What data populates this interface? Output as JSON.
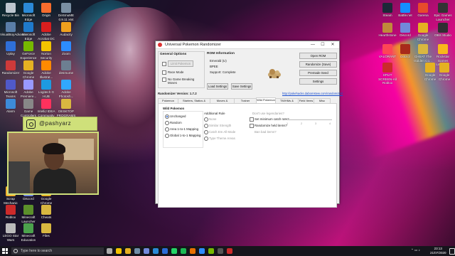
{
  "desktop_left": [
    {
      "label": "Recycle Bin",
      "color": "#bcc6cf"
    },
    {
      "label": "Microsoft Edge",
      "color": "#2b8ad6"
    },
    {
      "label": "Origin",
      "color": "#f56c2d"
    },
    {
      "label": "DeSmuME 0.9.11 x64",
      "color": "#7a8fa3"
    },
    {
      "label": "VisualBoyAdvance",
      "color": "#5a7ea8"
    },
    {
      "label": "Microsoft Edge",
      "color": "#1f7acb"
    },
    {
      "label": "Adobe Acrobat DC",
      "color": "#d81e1e"
    },
    {
      "label": "Audacity",
      "color": "#f0a01e"
    },
    {
      "label": "Uplay",
      "color": "#2f6fd8"
    },
    {
      "label": "GeForce Experience",
      "color": "#76b900"
    },
    {
      "label": "Norton Security",
      "color": "#f3c400"
    },
    {
      "label": "Zoom",
      "color": "#2d8cff"
    },
    {
      "label": "Randomizer",
      "color": "#cf3a3a"
    },
    {
      "label": "Google Chrome",
      "color": "#e5b122"
    },
    {
      "label": "Adobe Illustrat...",
      "color": "#ff8a00"
    },
    {
      "label": "desmume",
      "color": "#6d7f91"
    },
    {
      "label": "Microsoft Teams",
      "color": "#5059c9"
    },
    {
      "label": "Adobe Premiere...",
      "color": "#9999ff"
    },
    {
      "label": "Logitech G HUB",
      "color": "#1e9ae0"
    },
    {
      "label": "Adobe Photosh...",
      "color": "#31a8ff"
    },
    {
      "label": "Alarm",
      "color": "#3d8bd8"
    },
    {
      "label": "Game Controllers",
      "color": "#888888"
    },
    {
      "label": "IntelliJ IDEA Community",
      "color": "#fe315d"
    },
    {
      "label": "DESKTOP PROGRAMS",
      "color": "#d9b740"
    }
  ],
  "desktop_left_bottom": [
    {
      "label": "Scrap Mechanic",
      "color": "#f0b030"
    },
    {
      "label": "Discord",
      "color": "#7289da"
    },
    {
      "label": "Google Chrome",
      "color": "#e5b122"
    },
    {
      "label": "Roblox",
      "color": "#cc2a2a"
    },
    {
      "label": "Minecraft Launcher",
      "color": "#5b8f2b"
    },
    {
      "label": "Cheats",
      "color": "#d9b740"
    },
    {
      "label": "LEGO Star Wars",
      "color": "#bbbbbb"
    },
    {
      "label": "Minecraft Education",
      "color": "#4ca24c"
    },
    {
      "label": "Files",
      "color": "#d9b740"
    }
  ],
  "desktop_right": [
    {
      "label": "Steam",
      "color": "#1b2838"
    },
    {
      "label": "Battle.net",
      "color": "#148eff"
    },
    {
      "label": "Garena",
      "color": "#e84b2b"
    },
    {
      "label": "Epic Games Launcher",
      "color": "#333333"
    },
    {
      "label": "Hearthstone",
      "color": "#c08a3a"
    },
    {
      "label": "Discord",
      "color": "#7289da"
    },
    {
      "label": "Google Chrome",
      "color": "#e5b122"
    },
    {
      "label": "OBS Studio",
      "color": "#302e31"
    },
    {
      "label": "VALORANT",
      "color": "#fd4556"
    },
    {
      "label": "Dota 2",
      "color": "#a82a1a"
    },
    {
      "label": "CHEAT The Golden Co...",
      "color": "#d9b740"
    },
    {
      "label": "Rockstar Games Launcher",
      "color": "#f9b81b"
    },
    {
      "label": "SPLIT SCREEN-All Roblox",
      "color": "#cc2a2a"
    },
    {
      "label": "Google Chrome",
      "color": "#e5b122"
    },
    {
      "label": "Google Chrome",
      "color": "#e5b122"
    }
  ],
  "window": {
    "title": "Universal Pokemon Randomizer",
    "minimize": "—",
    "maximize": "☐",
    "close": "✕",
    "general_options": {
      "heading": "General Options",
      "limit_pokemon": "Limit Pokemon",
      "race_mode": "Race Mode",
      "no_game_breaking": "No Game Breaking Moves"
    },
    "rom_info": {
      "heading": "ROM Information",
      "name": "Emerald (U)",
      "code": "BPEE",
      "support": "Support: Complete"
    },
    "load_settings": "Load Settings",
    "save_settings": "Save Settings",
    "open_rom": "Open ROM",
    "randomize_save": "Randomize (Save)",
    "premade_seed": "Premade Seed",
    "settings": "Settings",
    "version": "Randomizer Version: 1.7.2",
    "link": "http://pokehacks.dabomstew.com/randomizer/",
    "tabs": [
      "Pokemon Traits",
      "Starters, Statics & Trades",
      "Moves & Movesets",
      "Trainer Pokemon",
      "Wild Pokemon",
      "TM/HMs & Tutors",
      "Field Items",
      "Misc Tweaks"
    ],
    "panel": {
      "heading": "Wild Pokemon",
      "radios": [
        "Unchanged",
        "Random",
        "Area 1-to-1 Mapping",
        "Global 1-to-1 Mapping"
      ],
      "additional_rule": "Additional Rule",
      "rules": [
        "None",
        "Similar Strength",
        "Catch Em All Mode",
        "Type Theme Areas"
      ],
      "dont_use_legendaries": "Don't use legendaries?",
      "set_min_catch": "Set minimum catch rate?",
      "randomize_held": "Randomize held items?",
      "ban_bad_items": "Ban bad items?",
      "slider_ticks": [
        "1",
        "2",
        "3",
        "4"
      ]
    }
  },
  "webcam": {
    "handle": "@pashyarz"
  },
  "taskbar": {
    "search_placeholder": "Type here to search",
    "time": "23:13",
    "date": "21/07/2020",
    "icons": [
      {
        "name": "task-view-icon",
        "color": "#aaaaaa"
      },
      {
        "name": "file-explorer-icon",
        "color": "#f3c400"
      },
      {
        "name": "chrome-icon",
        "color": "#e5b122"
      },
      {
        "name": "steam-icon",
        "color": "#6f8ea8"
      },
      {
        "name": "discord-icon",
        "color": "#7289da"
      },
      {
        "name": "edge-icon",
        "color": "#2b8ad6"
      },
      {
        "name": "photos-icon",
        "color": "#2b6cd6"
      },
      {
        "name": "whatsapp-icon",
        "color": "#25d366"
      },
      {
        "name": "spotify-icon",
        "color": "#1db954"
      },
      {
        "name": "java-icon",
        "color": "#e76f00"
      },
      {
        "name": "zoom-icon",
        "color": "#2d8cff"
      },
      {
        "name": "nvidia-icon",
        "color": "#76b900"
      },
      {
        "name": "obs-icon",
        "color": "#555555"
      },
      {
        "name": "roblox-icon",
        "color": "#cc2a2a"
      }
    ]
  }
}
